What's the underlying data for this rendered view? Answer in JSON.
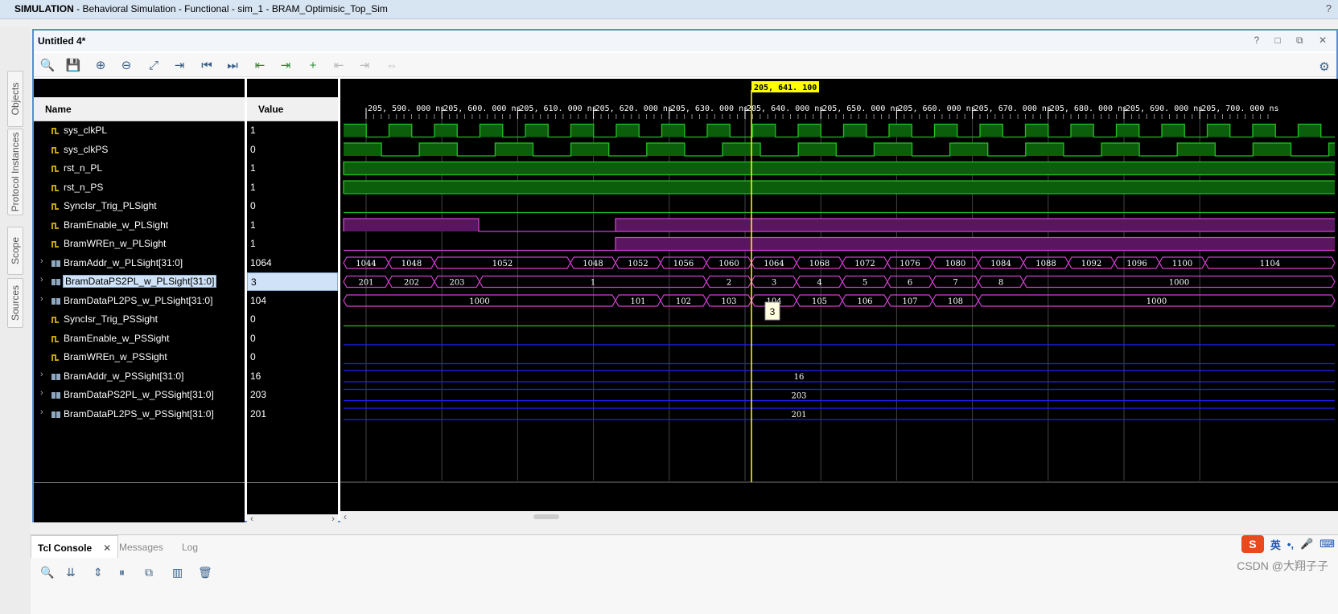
{
  "titlebar": {
    "prefix": "SIMULATION",
    "rest": " - Behavioral Simulation - Functional - sim_1 - BRAM_Optimisic_Top_Sim",
    "help": "?"
  },
  "vtabs": {
    "objects": "Objects",
    "protocol": "Protocol Instances",
    "scope": "Scope",
    "sources": "Sources"
  },
  "window": {
    "title": "Untitled 4*",
    "controls": "? □ ⧉ ✕"
  },
  "toolbar": [
    {
      "name": "search-icon",
      "glyph": "🔍",
      "cls": ""
    },
    {
      "name": "save-icon",
      "glyph": "💾",
      "cls": ""
    },
    {
      "name": "zoom-in-icon",
      "glyph": "⊕",
      "cls": ""
    },
    {
      "name": "zoom-out-icon",
      "glyph": "⊖",
      "cls": ""
    },
    {
      "name": "zoom-fit-icon",
      "glyph": "⤢",
      "cls": ""
    },
    {
      "name": "go-to-cursor-icon",
      "glyph": "⇥",
      "cls": ""
    },
    {
      "name": "go-to-start-icon",
      "glyph": "⏮",
      "cls": ""
    },
    {
      "name": "go-to-end-icon",
      "glyph": "⏭",
      "cls": ""
    },
    {
      "name": "previous-transition-icon",
      "glyph": "⇤",
      "cls": "green"
    },
    {
      "name": "next-transition-icon",
      "glyph": "⇥",
      "cls": "green"
    },
    {
      "name": "add-marker-icon",
      "glyph": "+",
      "cls": "green"
    },
    {
      "name": "previous-marker-icon",
      "glyph": "⇤",
      "cls": "dis"
    },
    {
      "name": "next-marker-icon",
      "glyph": "⇥",
      "cls": "dis"
    },
    {
      "name": "swap-cursors-icon",
      "glyph": "⇔",
      "cls": "dis"
    }
  ],
  "columns": {
    "name": "Name",
    "value": "Value"
  },
  "signals": [
    {
      "name": "sys_clkPL",
      "value": "1",
      "bus": false
    },
    {
      "name": "sys_clkPS",
      "value": "0",
      "bus": false
    },
    {
      "name": "rst_n_PL",
      "value": "1",
      "bus": false
    },
    {
      "name": "rst_n_PS",
      "value": "1",
      "bus": false
    },
    {
      "name": "SyncIsr_Trig_PLSight",
      "value": "0",
      "bus": false
    },
    {
      "name": "BramEnable_w_PLSight",
      "value": "1",
      "bus": false
    },
    {
      "name": "BramWREn_w_PLSight",
      "value": "1",
      "bus": false
    },
    {
      "name": "BramAddr_w_PLSight[31:0]",
      "value": "1064",
      "bus": true
    },
    {
      "name": "BramDataPS2PL_w_PLSight[31:0]",
      "value": "3",
      "bus": true,
      "selected": true
    },
    {
      "name": "BramDataPL2PS_w_PLSight[31:0]",
      "value": "104",
      "bus": true
    },
    {
      "name": "SyncIsr_Trig_PSSight",
      "value": "0",
      "bus": false
    },
    {
      "name": "BramEnable_w_PSSight",
      "value": "0",
      "bus": false
    },
    {
      "name": "BramWREn_w_PSSight",
      "value": "0",
      "bus": false
    },
    {
      "name": "BramAddr_w_PSSight[31:0]",
      "value": "16",
      "bus": true
    },
    {
      "name": "BramDataPS2PL_w_PSSight[31:0]",
      "value": "203",
      "bus": true
    },
    {
      "name": "BramDataPL2PS_w_PSSight[31:0]",
      "value": "201",
      "bus": true
    }
  ],
  "timeline": {
    "cursor_label": "205, 641. 100 ns",
    "tick_labels": [
      "205, 590. 000 ns",
      "205, 600. 000 ns",
      "205, 610. 000 ns",
      "205, 620. 000 ns",
      "205, 630. 000 ns",
      "205, 640. 000 ns",
      "205, 650. 000 ns",
      "205, 660. 000 ns",
      "205, 670. 000 ns",
      "205, 680. 000 ns",
      "205, 690. 000 ns",
      "205, 700. 000 ns"
    ],
    "hover_value": "3"
  },
  "waves": {
    "bram_addr_pl": [
      "1044",
      "1048",
      "1052",
      "1048",
      "1052",
      "1056",
      "1060",
      "1064",
      "1068",
      "1072",
      "1076",
      "1080",
      "1084",
      "1088",
      "1092",
      "1096",
      "1100",
      "1104"
    ],
    "bram_ps2pl_pl": [
      "201",
      "202",
      "203",
      "1",
      "2",
      "3",
      "4",
      "5",
      "6",
      "7",
      "8",
      "1000"
    ],
    "bram_pl2ps_pl": [
      "1000",
      "101",
      "102",
      "103",
      "104",
      "105",
      "106",
      "107",
      "108",
      "1000"
    ],
    "bram_addr_ps": "16",
    "bram_ps2pl_ps": "203",
    "bram_pl2ps_ps": "201"
  },
  "colors": {
    "green": "#22c022",
    "green_fill": "#0b5f0b",
    "magenta": "#d040d0",
    "magenta_fill": "#5a1560",
    "blue": "#2020ff",
    "cursor": "#ffff00"
  },
  "bottom": {
    "tabs": [
      "Tcl Console",
      "Messages",
      "Log"
    ],
    "watermark": "CSDN @大翔子子",
    "ime_logo": "S",
    "ime_lang": "英"
  }
}
